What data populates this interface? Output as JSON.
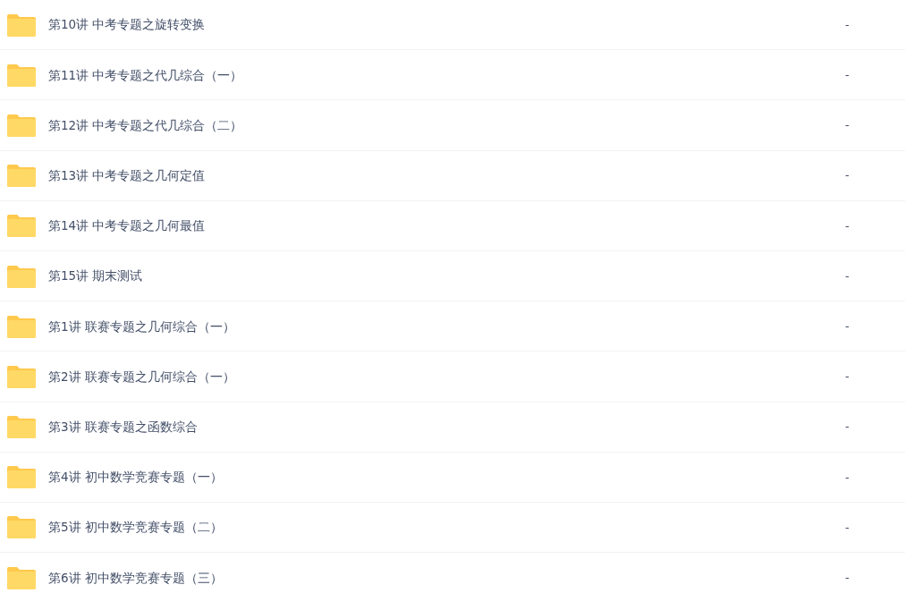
{
  "files": [
    {
      "name": "第10讲 中考专题之旋转变换",
      "size": "-"
    },
    {
      "name": "第11讲 中考专题之代几综合（一）",
      "size": "-"
    },
    {
      "name": "第12讲 中考专题之代几综合（二）",
      "size": "-"
    },
    {
      "name": "第13讲 中考专题之几何定值",
      "size": "-"
    },
    {
      "name": "第14讲 中考专题之几何最值",
      "size": "-"
    },
    {
      "name": "第15讲 期末测试",
      "size": "-"
    },
    {
      "name": "第1讲 联赛专题之几何综合（一）",
      "size": "-"
    },
    {
      "name": "第2讲 联赛专题之几何综合（一）",
      "size": "-"
    },
    {
      "name": "第3讲 联赛专题之函数综合",
      "size": "-"
    },
    {
      "name": "第4讲 初中数学竞赛专题（一）",
      "size": "-"
    },
    {
      "name": "第5讲 初中数学竞赛专题（二）",
      "size": "-"
    },
    {
      "name": "第6讲 初中数学竞赛专题（三）",
      "size": "-"
    }
  ]
}
